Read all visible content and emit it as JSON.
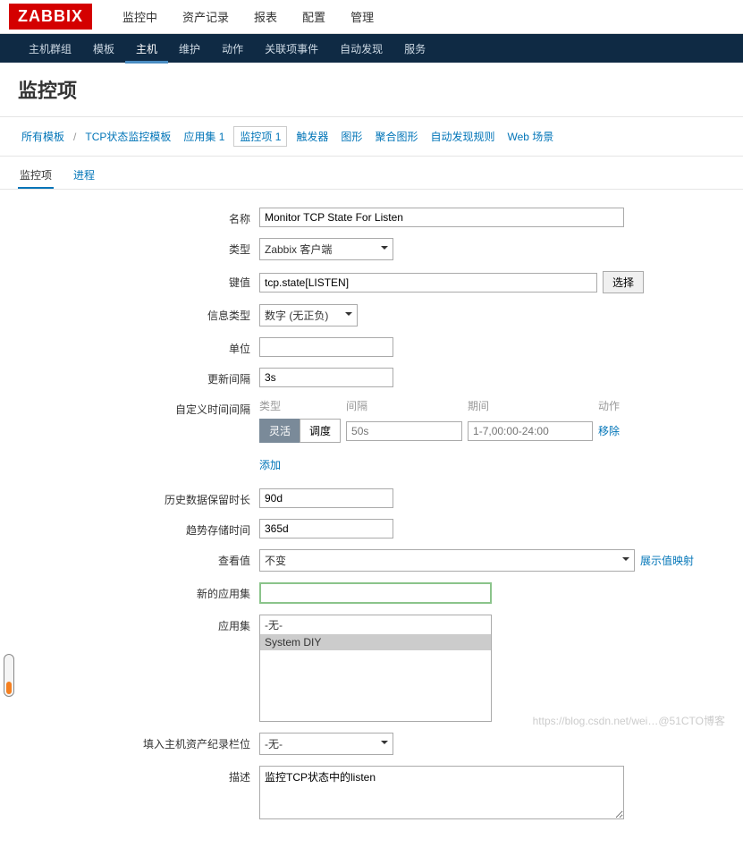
{
  "logo": "ZABBIX",
  "topnav": {
    "monitoring": "监控中",
    "inventory": "资产记录",
    "reports": "报表",
    "configuration": "配置",
    "administration": "管理"
  },
  "subnav": {
    "hostgroups": "主机群组",
    "templates": "模板",
    "hosts": "主机",
    "maintenance": "维护",
    "actions": "动作",
    "correlation": "关联项事件",
    "discovery": "自动发现",
    "services": "服务"
  },
  "page_title": "监控项",
  "breadcrumb": {
    "all_templates": "所有模板",
    "template_name": "TCP状态监控模板",
    "applications": "应用集 1",
    "items": "监控项 1",
    "triggers": "触发器",
    "graphs": "图形",
    "screens": "聚合图形",
    "discovery": "自动发现规则",
    "web": "Web 场景"
  },
  "subtabs": {
    "item": "监控项",
    "process": "进程"
  },
  "form": {
    "labels": {
      "name": "名称",
      "type": "类型",
      "key": "键值",
      "info_type": "信息类型",
      "units": "单位",
      "update_interval": "更新间隔",
      "custom_intervals": "自定义时间间隔",
      "history": "历史数据保留时长",
      "trends": "趋势存储时间",
      "show_value": "查看值",
      "new_application": "新的应用集",
      "applications": "应用集",
      "inventory_link": "填入主机资产纪录栏位",
      "description": "描述"
    },
    "values": {
      "name": "Monitor TCP State For Listen",
      "type": "Zabbix 客户端",
      "key": "tcp.state[LISTEN]",
      "key_select": "选择",
      "info_type": "数字 (无正负)",
      "units": "",
      "update_interval": "3s",
      "history": "90d",
      "trends": "365d",
      "show_value": "不变",
      "show_value_link": "展示值映射",
      "new_application": "",
      "app_none": "-无-",
      "app_system": "System DIY",
      "inventory_link": "-无-",
      "description": "监控TCP状态中的listen"
    },
    "interval_table": {
      "head_type": "类型",
      "head_interval": "间隔",
      "head_period": "期间",
      "head_action": "动作",
      "seg_flex": "灵活",
      "seg_sched": "调度",
      "ph_interval": "50s",
      "ph_period": "1-7,00:00-24:00",
      "remove": "移除",
      "add": "添加"
    }
  },
  "watermark": "https://blog.csdn.net/wei…@51CTO博客"
}
